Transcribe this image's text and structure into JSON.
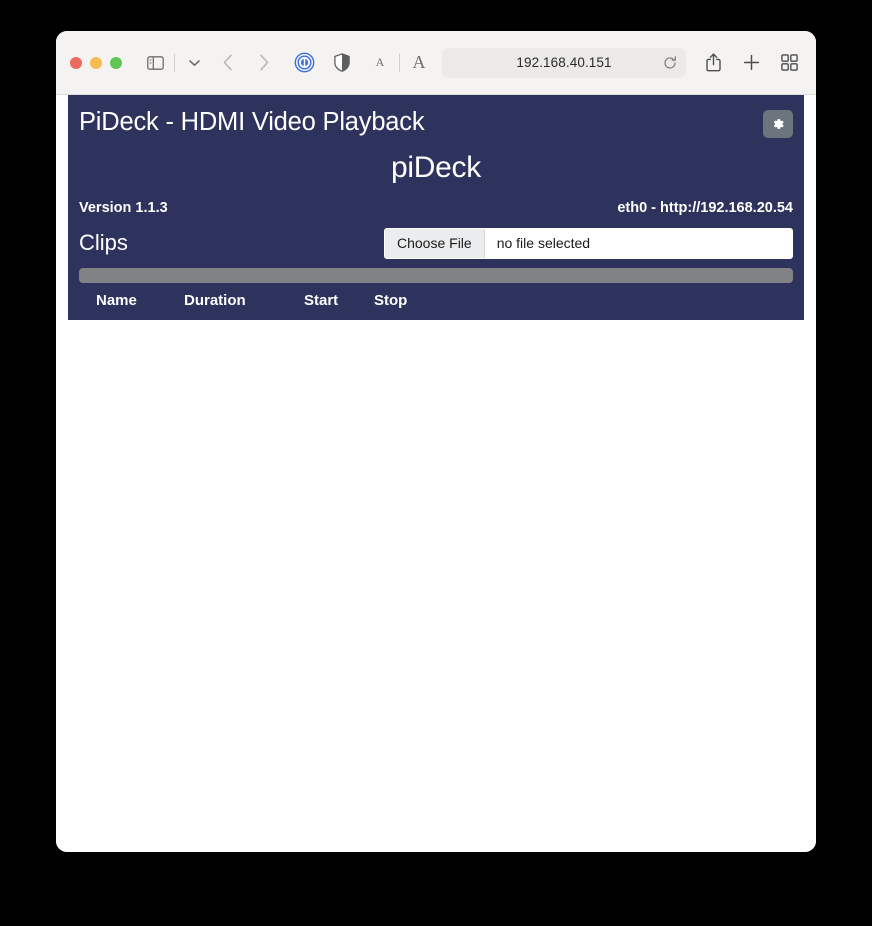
{
  "browser": {
    "traffic_lights": [
      "close",
      "minimize",
      "maximize"
    ],
    "url": "192.168.40.151",
    "icons": {
      "sidebar": "sidebar-icon",
      "tab_overview_chevron": "chevron-down-icon",
      "back": "chevron-left-icon",
      "forward": "chevron-right-icon",
      "privacy": "privacy-report-icon",
      "shield": "shield-icon",
      "font_small": "A",
      "font_large": "A",
      "reload": "reload-icon",
      "share": "share-icon",
      "new_tab": "plus-icon",
      "tab_overview": "tab-overview-icon"
    }
  },
  "app": {
    "title": "PiDeck - HDMI Video Playback",
    "settings_icon": "gear-icon",
    "brand": "piDeck",
    "version": "Version 1.1.3",
    "network": "eth0 - http://192.168.20.54",
    "clips_heading": "Clips",
    "upload": {
      "button_label": "Choose File",
      "file_status": "no file selected"
    },
    "progress": {
      "value": 100,
      "color": "#808285"
    },
    "table": {
      "headers": [
        "Name",
        "Duration",
        "Start",
        "Stop"
      ],
      "rows": []
    },
    "colors": {
      "panel_bg": "#2d335c",
      "gear_btn": "#6c757d",
      "text": "#ffffff"
    }
  }
}
